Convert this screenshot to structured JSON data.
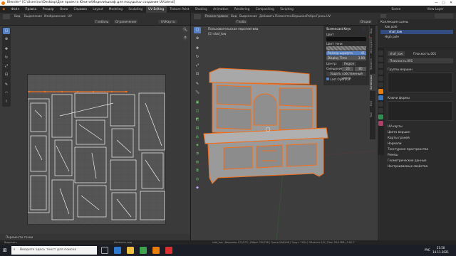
{
  "window": {
    "title": "Blender* [C:\\Users\\nv\\Desktop\\Для проекта Юнити\\Модели\\шкаф для посуды\\uv создание UV.blend]"
  },
  "menu": [
    "Файл",
    "Правка",
    "Рендер",
    "Окно",
    "Справка"
  ],
  "workspaces": [
    "Layout",
    "Modeling",
    "Sculpting",
    "UV Editing",
    "Texture Paint",
    "Shading",
    "Animation",
    "Rendering",
    "Compositing",
    "Scripting"
  ],
  "active_workspace": "UV Editing",
  "scene": {
    "name": "Scene",
    "view_layer": "View Layer"
  },
  "uv_editor": {
    "menus": [
      "Вид",
      "Выделение",
      "Изображение",
      "UV"
    ],
    "sync_label": "Глобаль",
    "pivot_label": "Ограничение",
    "map_name": "UVКарта",
    "footer": "Перемести точки"
  },
  "viewport": {
    "menus": [
      "Вид",
      "Выделение",
      "Добавить",
      "Полисетка",
      "Вершина",
      "Ребро",
      "Грань",
      "UV"
    ],
    "mode": "Режим правки",
    "orientation": "Глоба",
    "overlay_label": "Опции",
    "info_line1": "Пользовательская перспектива",
    "info_line2": "(1) shaf_low"
  },
  "screencast_panel": {
    "title": "Screencast Keys",
    "color_label": "Цвет",
    "shadow_label": "Цвет тени",
    "font_size_label": "Размер шрифта",
    "font_size_value": "41",
    "display_time_label": "Display Time",
    "display_time_value": "3.00",
    "origin_label": "Центр:",
    "origin_value": "Region",
    "offset_label": "Смещение",
    "offset_x": "20",
    "offset_y": "80",
    "set_origin_button": "Задать собственный центр",
    "last_operator_label": "Last Operator"
  },
  "n_panel_tabs": [
    "Вид",
    "Инструмент",
    "Элемент",
    "Screencast",
    "Edit",
    "Tool"
  ],
  "outliner": {
    "header": "Коллекция сцены",
    "items": [
      "Коллекция сцены",
      "low pole",
      "shaf_low",
      "High pole"
    ]
  },
  "properties": {
    "object_name": "shaf_low",
    "data_name": "Плоскость.001",
    "mesh_field": "Плоскость.001",
    "vertex_groups": "Группы вершин",
    "shape_keys": "Ключи формы",
    "uv_maps": "UV-карты",
    "vertex_colors": "Цвета вершин",
    "face_maps": "Карты граней",
    "normals": "Нормали",
    "texture_space": "Текстурное пространство",
    "remesh": "Ремеш",
    "geometry_data": "Геометрические данные",
    "custom_props": "Настраиваемые свойства"
  },
  "statusbar": {
    "left": "Выделить",
    "mid": "Изменить вид",
    "right": "shaf_low | Вершины 571/572 | Рёбра 735/758 | Грани 246/246 | Треуг. 1024 | Объекты 1/5 | Пам: 28.0 MiB | 2.82.7"
  },
  "taskbar": {
    "search_placeholder": "Введите здесь текст для поиска",
    "time": "21:50",
    "date": "14.11.2021",
    "lang": "РУС"
  },
  "colors": {
    "accent": "#5680c2",
    "edit_orange": "#f07020",
    "blender_orange": "#e87d0d"
  }
}
